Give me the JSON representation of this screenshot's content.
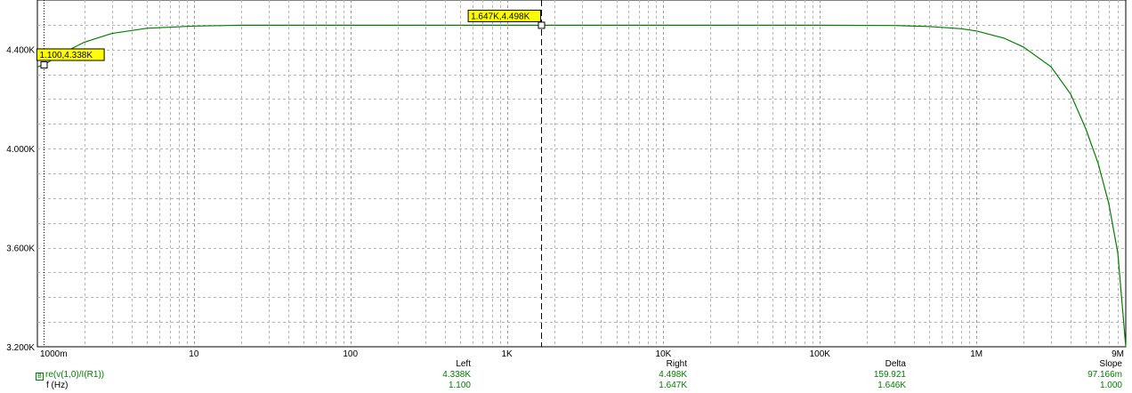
{
  "chart_data": {
    "type": "line",
    "x_scale": "log",
    "xlim": [
      1,
      9000000
    ],
    "ylim": [
      3200,
      4600
    ],
    "grid": true,
    "xticks": [
      {
        "value": 1,
        "label": "1000m"
      },
      {
        "value": 10,
        "label": "10"
      },
      {
        "value": 100,
        "label": "100"
      },
      {
        "value": 1000,
        "label": "1K"
      },
      {
        "value": 10000,
        "label": "10K"
      },
      {
        "value": 100000,
        "label": "100K"
      },
      {
        "value": 1000000,
        "label": "1M"
      },
      {
        "value": 9000000,
        "label": "9M"
      }
    ],
    "yticks": [
      {
        "value": 3200,
        "label": "3.200K"
      },
      {
        "value": 3600,
        "label": "3.600K"
      },
      {
        "value": 4000,
        "label": "4.000K"
      },
      {
        "value": 4400,
        "label": "4.400K"
      }
    ],
    "series": [
      {
        "name": "re(v(1,0)/I(R1))",
        "color": "#007f00",
        "x": [
          1,
          1.1,
          1.5,
          2,
          3,
          5,
          10,
          20,
          50,
          100,
          1000,
          10000,
          100000,
          300000,
          500000,
          800000,
          1000000,
          1500000,
          2000000,
          3000000,
          4000000,
          5000000,
          6000000,
          7000000,
          8000000,
          9000000
        ],
        "y": [
          4330,
          4338,
          4390,
          4430,
          4465,
          4486,
          4495,
          4498,
          4498,
          4498,
          4498,
          4498,
          4498,
          4497,
          4493,
          4484,
          4475,
          4446,
          4410,
          4330,
          4220,
          4080,
          3940,
          3780,
          3580,
          3200
        ]
      }
    ],
    "cursors": [
      {
        "x": 1.1,
        "y": 4338,
        "label": "1.100,4.338K",
        "style": "dotted"
      },
      {
        "x": 1647,
        "y": 4498,
        "label": "1.647K,4.498K",
        "style": "dashed"
      }
    ]
  },
  "readout": {
    "trace_name": "re(v(1,0)/I(R1))",
    "trace_marker": "B",
    "x_name": "f (Hz)",
    "columns": [
      {
        "header": "Left",
        "trace_value": "4.338K",
        "x_value": "1.100"
      },
      {
        "header": "Right",
        "trace_value": "4.498K",
        "x_value": "1.647K"
      },
      {
        "header": "Delta",
        "trace_value": "159.921",
        "x_value": "1.646K"
      },
      {
        "header": "Slope",
        "trace_value": "97.166m",
        "x_value": "1.000"
      }
    ]
  }
}
